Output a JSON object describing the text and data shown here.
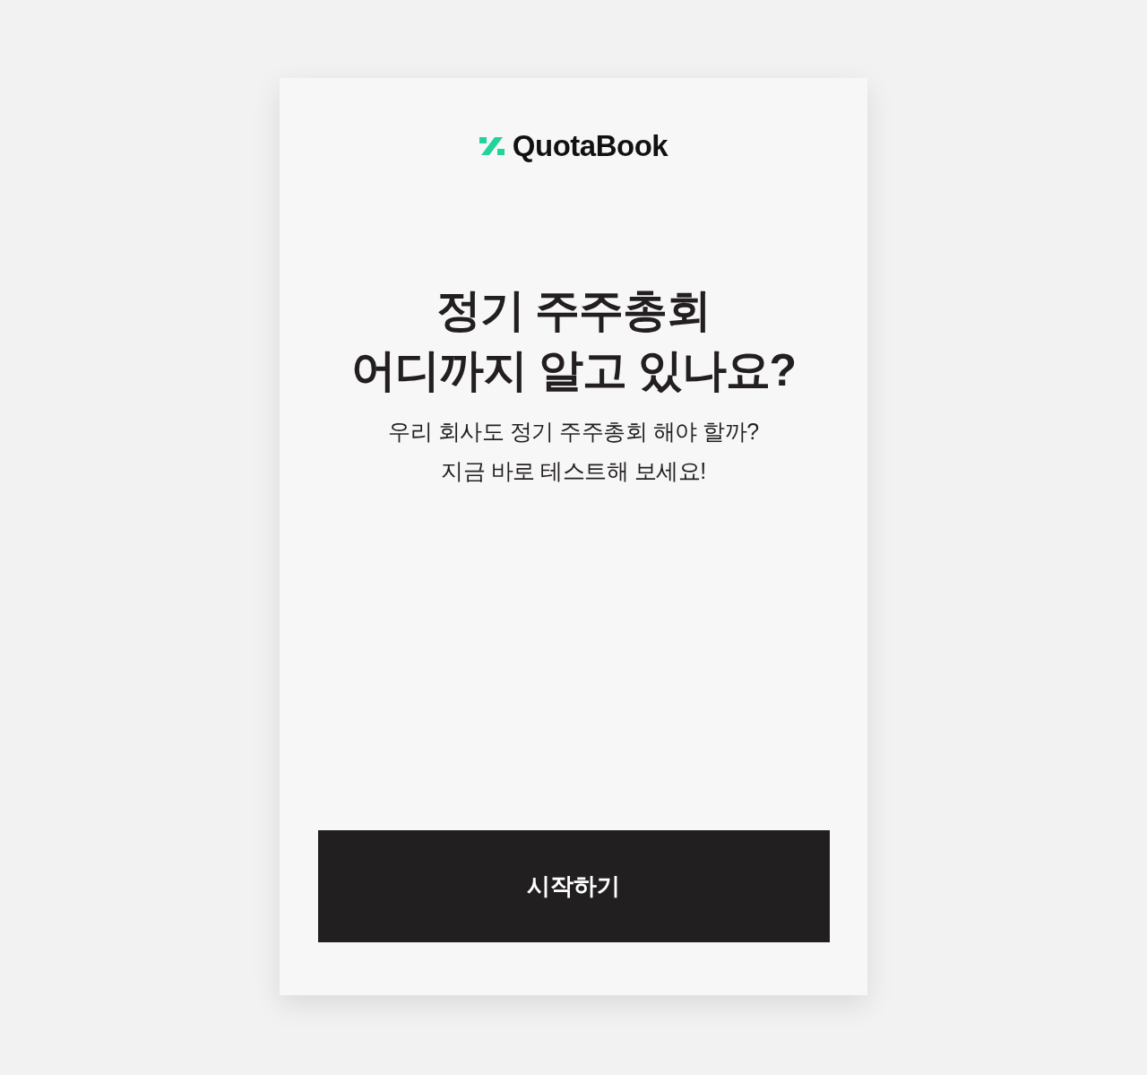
{
  "logo": {
    "text": "QuotaBook"
  },
  "headline": {
    "lines": [
      "정기 주주총회",
      "어디까지 알고 있나요?"
    ]
  },
  "subtitle": {
    "lines": [
      "우리 회사도 정기 주주총회 해야 할까?",
      "지금 바로 테스트해 보세요!"
    ]
  },
  "start_button": {
    "label": "시작하기"
  }
}
